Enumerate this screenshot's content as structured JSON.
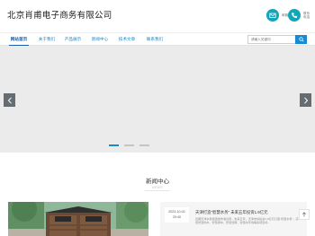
{
  "header": {
    "site_title": "北京肖甫电子商务有限公司",
    "mail_label": "邮箱",
    "phone_label": "联系电话"
  },
  "nav": {
    "items": [
      {
        "label": "网站首页",
        "active": true
      },
      {
        "label": "关于我们",
        "active": false
      },
      {
        "label": "产品展示",
        "active": false
      },
      {
        "label": "新闻中心",
        "active": false
      },
      {
        "label": "技术文章",
        "active": false
      },
      {
        "label": "联系我们",
        "active": false
      }
    ],
    "search_placeholder": "请输入关键词"
  },
  "banner": {
    "slide_count": 3,
    "active_slide": 0
  },
  "news": {
    "title": "新闻中心",
    "subtitle": "NEWS",
    "featured": {
      "date_ym": "2023-10-02",
      "date_time": "20:40",
      "headline": "天津打造“智慧水务” 未来五年投资1.9亿元",
      "excerpt": "近期天津水务集团发布消息称，未来五年，天津市将投资1.9亿元打造“智慧水务”，实现智慧供水、智慧排水、智慧管网、智慧水环境等多项目标…"
    }
  },
  "colors": {
    "brand_teal": "#13a5b8",
    "link_blue": "#1987c8",
    "button_blue": "#1a8ad0",
    "banner_bg": "#ebebeb"
  },
  "icons": {
    "mail": "mail-icon",
    "phone": "phone-icon",
    "search": "search-icon",
    "prev": "chevron-left-icon",
    "next": "chevron-right-icon",
    "top": "arrow-up-icon"
  }
}
